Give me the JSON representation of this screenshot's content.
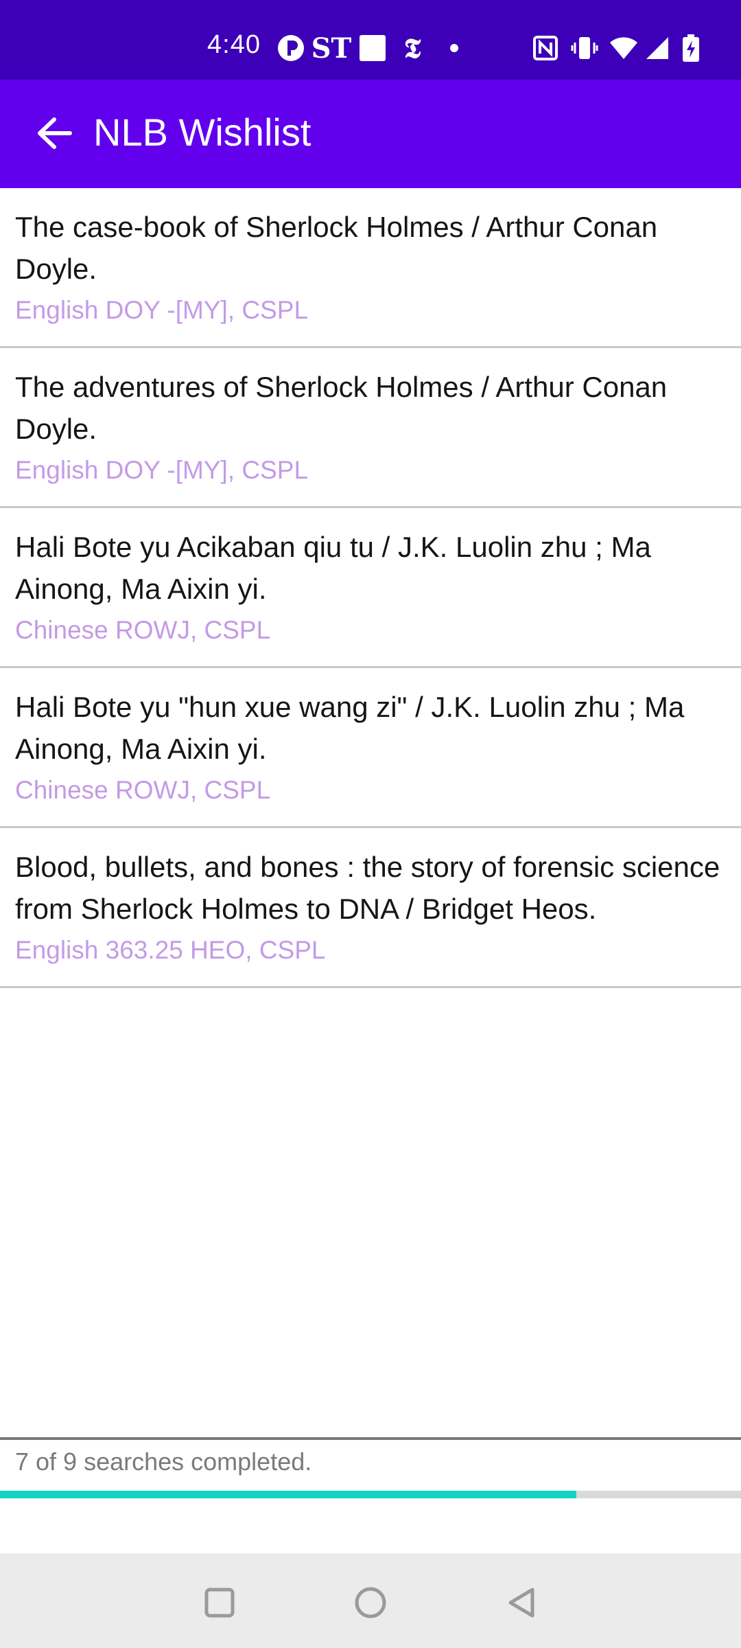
{
  "status_bar": {
    "time": "4:40",
    "icons_left": [
      "circle-p-icon",
      "st-logo-icon",
      "white-square-icon",
      "nyt-logo-icon",
      "dot-icon"
    ],
    "icons_right": [
      "nfc-icon",
      "vibrate-icon",
      "wifi-icon",
      "signal-icon",
      "battery-charging-icon"
    ]
  },
  "app_bar": {
    "title": "NLB Wishlist",
    "back_icon": "arrow-left-icon"
  },
  "books": [
    {
      "title": "The case-book of Sherlock Holmes / Arthur Conan Doyle.",
      "meta": "English DOY -[MY], CSPL"
    },
    {
      "title": "The adventures of Sherlock Holmes / Arthur Conan Doyle.",
      "meta": "English DOY -[MY], CSPL"
    },
    {
      "title": "Hali Bote yu Acikaban qiu tu / J.K. Luolin zhu ; Ma Ainong, Ma Aixin yi.",
      "meta": "Chinese ROWJ, CSPL"
    },
    {
      "title": "Hali Bote yu \"hun xue wang zi\" / J.K. Luolin zhu ; Ma Ainong, Ma Aixin yi.",
      "meta": "Chinese ROWJ, CSPL"
    },
    {
      "title": "Blood, bullets, and bones : the story of forensic science from Sherlock Holmes to DNA / Bridget Heos.",
      "meta": "English 363.25 HEO, CSPL"
    }
  ],
  "progress": {
    "text": "7 of 9 searches completed.",
    "fraction": 0.778,
    "bar_color": "#10d3c0"
  },
  "nav_bar": {
    "icons": [
      "recents-square-icon",
      "home-circle-icon",
      "back-triangle-icon"
    ]
  },
  "colors": {
    "status_bar": "#3d00b8",
    "app_bar": "#6200ee",
    "meta_text": "#c39ae6"
  }
}
